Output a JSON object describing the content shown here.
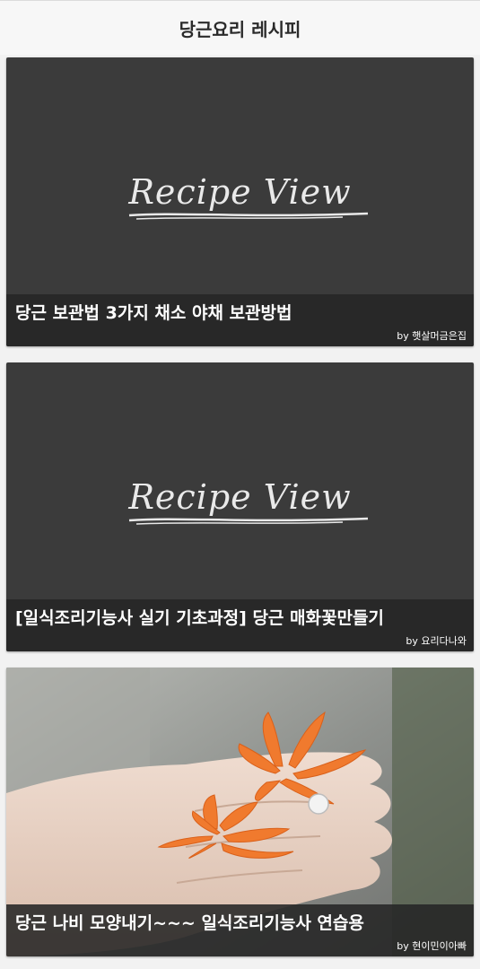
{
  "header": {
    "title": "당근요리 레시피"
  },
  "cards": [
    {
      "title": "당근 보관법 3가지 채소 야채 보관방법",
      "author": "by 햇살머금은집",
      "image": {
        "type": "placeholder",
        "text": "Recipe View"
      }
    },
    {
      "title": "[일식조리기능사 실기 기초과정] 당근 매화꽃만들기",
      "author": "by 요리다나와",
      "image": {
        "type": "placeholder",
        "text": "Recipe View"
      }
    },
    {
      "title": "당근 나비 모양내기~~~ 일식조리기능사 연습용",
      "author": "by 현이민이아빠",
      "image": {
        "type": "photo",
        "subject": "carrot butterfly cuts on hand"
      }
    }
  ],
  "colors": {
    "card_bg": "#3b3b3b",
    "caption_bg": "#262626",
    "carrot": "#f07a2e",
    "skin": "#e7d2c4"
  }
}
